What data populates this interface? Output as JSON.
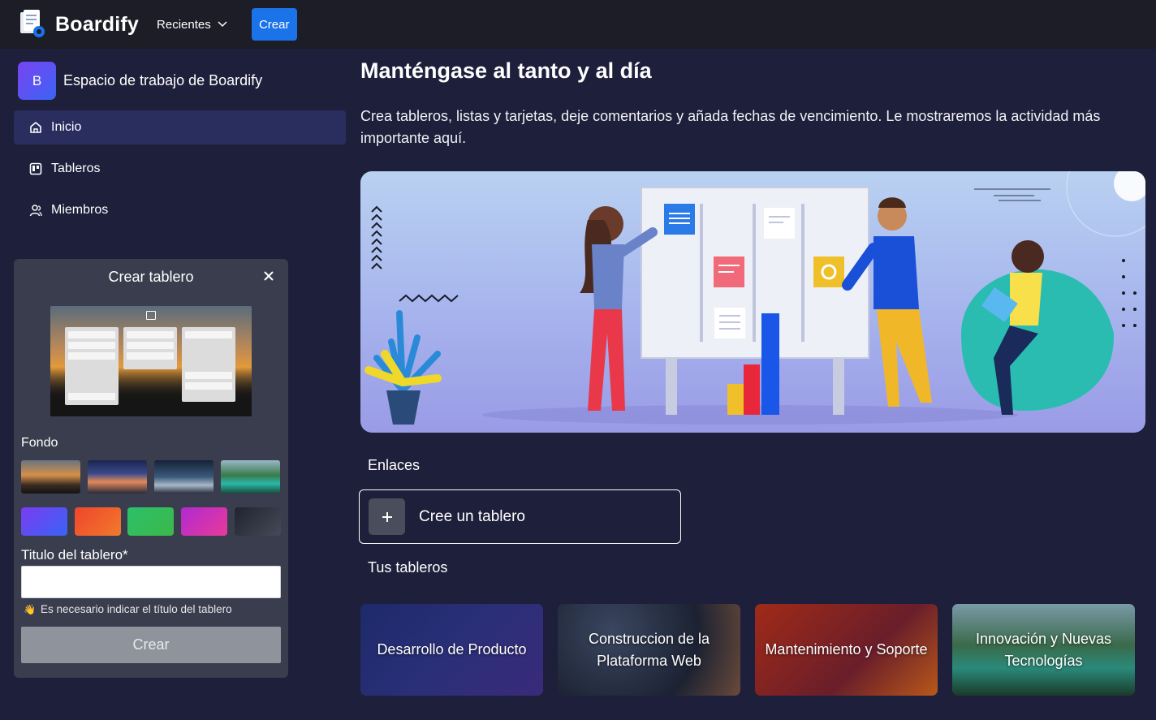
{
  "app": {
    "name": "Boardify"
  },
  "topbar": {
    "recientes_label": "Recientes",
    "crear_label": "Crear"
  },
  "sidebar": {
    "workspace": {
      "initial": "B",
      "name": "Espacio de trabajo de Boardify"
    },
    "items": [
      {
        "label": "Inicio",
        "icon": "home-icon",
        "active": true
      },
      {
        "label": "Tableros",
        "icon": "board-icon",
        "active": false
      },
      {
        "label": "Miembros",
        "icon": "members-icon",
        "active": false
      }
    ]
  },
  "create_board": {
    "title": "Crear tablero",
    "background_label": "Fondo",
    "background_images": [
      "forest-sunset",
      "night-sky",
      "planet-space",
      "mountain-lake"
    ],
    "background_colors": [
      "#5b4cf0",
      "#f05a2c",
      "#34b84e",
      "#d92fb8",
      "#2e3140"
    ],
    "title_label": "Titulo del tablero*",
    "title_value": "",
    "hint": "Es necesario indicar el título del tablero",
    "submit_label": "Crear"
  },
  "main": {
    "title": "Manténgase al tanto y al día",
    "description": "Crea tableros, listas y tarjetas, deje comentarios y añada fechas de vencimiento. Le mostraremos la actividad más importante aquí.",
    "links_label": "Enlaces",
    "create_link": {
      "icon": "plus-icon",
      "label": "Cree un tablero"
    },
    "boards_label": "Tus tableros",
    "boards": [
      {
        "title": "Desarrollo de Producto",
        "background": "#2a2f78"
      },
      {
        "title": "Construccion de la Plataforma Web",
        "background": "#2b3040"
      },
      {
        "title": "Mantenimiento y Soporte",
        "background": "#8a2a20"
      },
      {
        "title": "Innovación y Nuevas Tecnologías",
        "background": "#2f5a3a"
      }
    ]
  },
  "colors": {
    "accent": "#1a73e8",
    "topbar": "#1c1d27",
    "page": "#1e1f3b",
    "panel": "#3a3d4d"
  }
}
